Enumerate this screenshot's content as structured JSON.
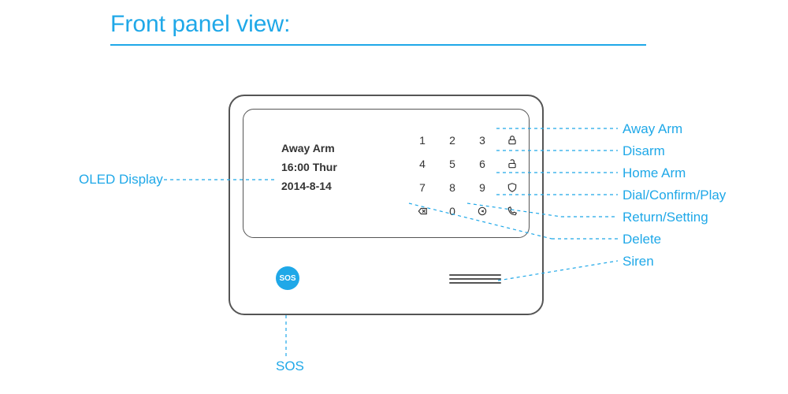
{
  "title": "Front panel view:",
  "display": {
    "line1": "Away Arm",
    "line2": "16:00 Thur",
    "line3": "2014-8-14"
  },
  "keypad": {
    "r1c1": "1",
    "r1c2": "2",
    "r1c3": "3",
    "r2c1": "4",
    "r2c2": "5",
    "r2c3": "6",
    "r3c1": "7",
    "r3c2": "8",
    "r3c3": "9",
    "r4c2": "0"
  },
  "sos_label": "SOS",
  "callouts": {
    "oled": "OLED Display",
    "away": "Away Arm",
    "disarm": "Disarm",
    "home": "Home Arm",
    "dial": "Dial/Confirm/Play",
    "return": "Return/Setting",
    "delete": "Delete",
    "siren": "Siren",
    "sos": "SOS"
  }
}
